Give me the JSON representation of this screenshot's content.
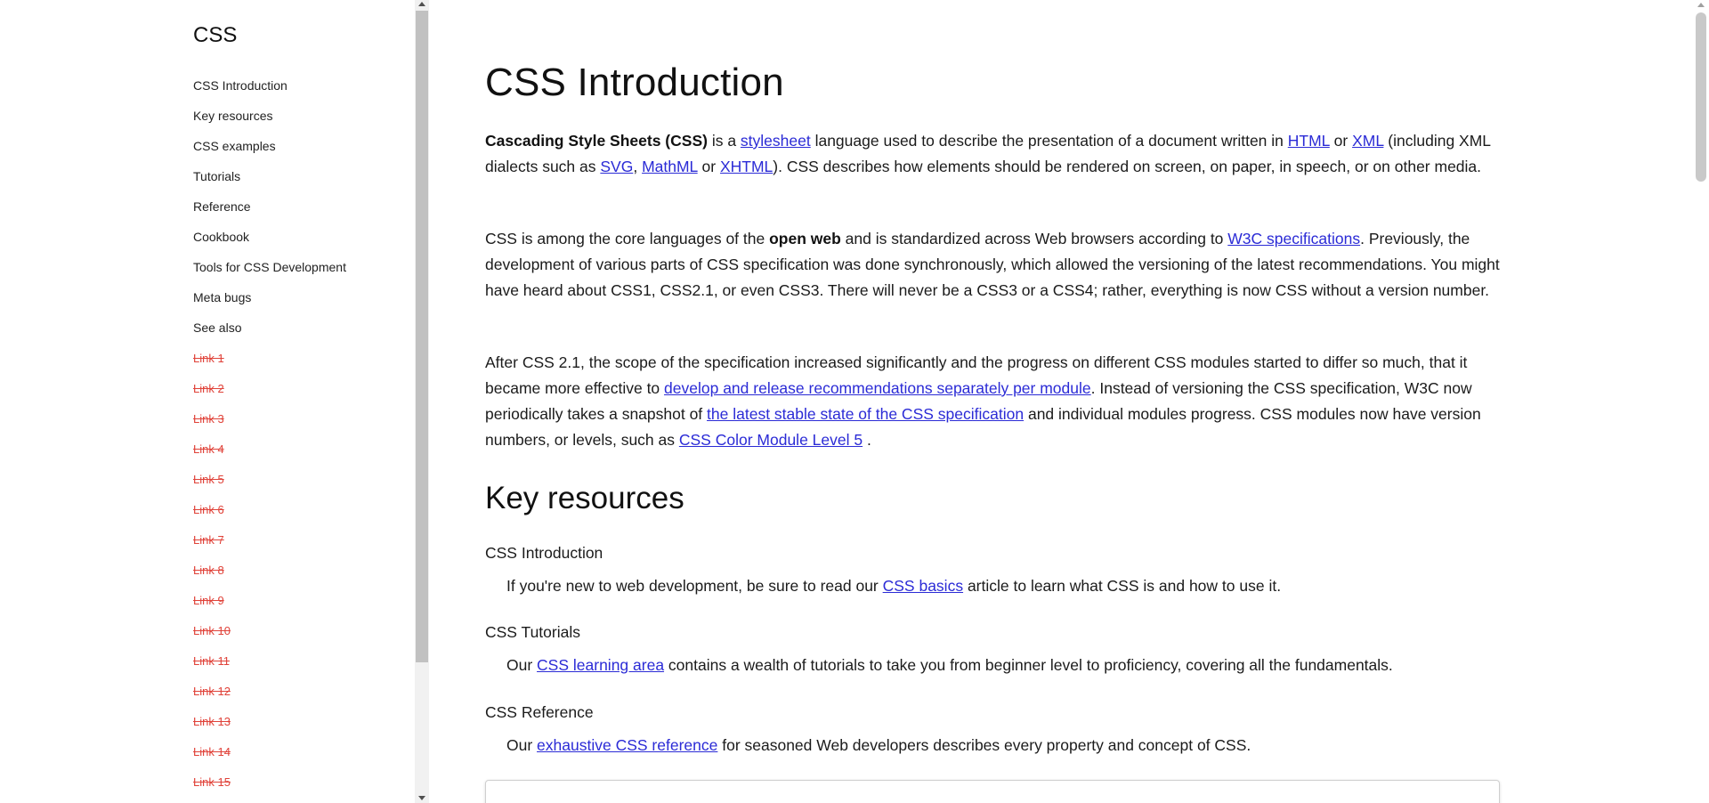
{
  "sidebar": {
    "title": "CSS",
    "items": [
      {
        "label": "CSS Introduction"
      },
      {
        "label": "Key resources"
      },
      {
        "label": "CSS examples"
      },
      {
        "label": "Tutorials"
      },
      {
        "label": "Reference"
      },
      {
        "label": "Cookbook"
      },
      {
        "label": "Tools for CSS Development"
      },
      {
        "label": "Meta bugs"
      },
      {
        "label": "See also"
      }
    ],
    "struck_links": [
      "Link 1",
      "Link 2",
      "Link 3",
      "Link 4",
      "Link 5",
      "Link 6",
      "Link 7",
      "Link 8",
      "Link 9",
      "Link 10",
      "Link 11",
      "Link 12",
      "Link 13",
      "Link 14",
      "Link 15"
    ]
  },
  "main": {
    "title": "CSS Introduction",
    "p1": {
      "bold": "Cascading Style Sheets (CSS)",
      "t1": " is a ",
      "link_stylesheet": "stylesheet",
      "t2": " language used to describe the presentation of a document written in ",
      "link_html": "HTML",
      "t3": " or ",
      "link_xml": "XML",
      "t4": " (including XML dialects such as ",
      "link_svg": "SVG",
      "t5": ", ",
      "link_mathml": "MathML",
      "t6": " or ",
      "link_xhtml": "XHTML",
      "t7": "). CSS describes how elements should be rendered on screen, on paper, in speech, or on other media."
    },
    "p2": {
      "t1": "CSS is among the core languages of the ",
      "bold": "open web",
      "t2": " and is standardized across Web browsers according to ",
      "link_w3c": "W3C specifications",
      "t3": ". Previously, the development of various parts of CSS specification was done synchronously, which allowed the versioning of the latest recommendations. You might have heard about CSS1, CSS2.1, or even CSS3. There will never be a CSS3 or a CSS4; rather, everything is now CSS without a version number."
    },
    "p3": {
      "t1": "After CSS 2.1, the scope of the specification increased significantly and the progress on different CSS modules started to differ so much, that it became more effective to ",
      "link_develop": "develop and release recommendations separately per module",
      "t2": ". Instead of versioning the CSS specification, W3C now periodically takes a snapshot of ",
      "link_stable": "the latest stable state of the CSS specification",
      "t3": " and individual modules progress. CSS modules now have version numbers, or levels, such as ",
      "link_color": "CSS Color Module Level 5",
      "t4": " ."
    },
    "key_resources": {
      "heading": "Key resources",
      "items": [
        {
          "term": "CSS Introduction",
          "t1": "If you're new to web development, be sure to read our ",
          "link": "CSS basics",
          "t2": " article to learn what CSS is and how to use it."
        },
        {
          "term": "CSS Tutorials",
          "t1": "Our ",
          "link": "CSS learning area",
          "t2": " contains a wealth of tutorials to take you from beginner level to proficiency, covering all the fundamentals."
        },
        {
          "term": "CSS Reference",
          "t1": "Our ",
          "link": "exhaustive CSS reference",
          "t2": " for seasoned Web developers describes every property and concept of CSS."
        }
      ]
    }
  }
}
